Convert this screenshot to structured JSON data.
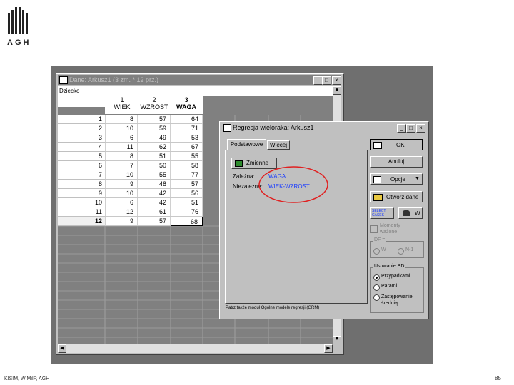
{
  "slide": {
    "logo_text": "AGH",
    "footer_left": "KISIM, WIMiIP, AGH",
    "page_number": "85"
  },
  "sheet_window": {
    "title": "Dane: Arkusz1 (3 zm. * 12 prz.)",
    "corner_label": "Dziecko",
    "columns": [
      {
        "num": "1",
        "name": "WIEK"
      },
      {
        "num": "2",
        "name": "WZROST"
      },
      {
        "num": "3",
        "name": "WAGA"
      }
    ],
    "rows": [
      {
        "n": "1",
        "values": [
          "8",
          "57",
          "64"
        ]
      },
      {
        "n": "2",
        "values": [
          "10",
          "59",
          "71"
        ]
      },
      {
        "n": "3",
        "values": [
          "6",
          "49",
          "53"
        ]
      },
      {
        "n": "4",
        "values": [
          "11",
          "62",
          "67"
        ]
      },
      {
        "n": "5",
        "values": [
          "8",
          "51",
          "55"
        ]
      },
      {
        "n": "6",
        "values": [
          "7",
          "50",
          "58"
        ]
      },
      {
        "n": "7",
        "values": [
          "10",
          "55",
          "77"
        ]
      },
      {
        "n": "8",
        "values": [
          "9",
          "48",
          "57"
        ]
      },
      {
        "n": "9",
        "values": [
          "10",
          "42",
          "56"
        ]
      },
      {
        "n": "10",
        "values": [
          "6",
          "42",
          "51"
        ]
      },
      {
        "n": "11",
        "values": [
          "12",
          "61",
          "76"
        ]
      },
      {
        "n": "12",
        "values": [
          "9",
          "57",
          "68"
        ]
      }
    ]
  },
  "dialog": {
    "title": "Regresja wieloraka: Arkusz1",
    "tabs": [
      "Podstawowe",
      "Więcej"
    ],
    "variables_button": "Zmienne",
    "dependent_label": "Zależna:",
    "dependent_value": "WAGA",
    "independent_label": "Niezależne:",
    "independent_value": "WIEK-WZROST",
    "status_text": "Patrz także moduł Ogólne modele regresji (GRM)",
    "ok_button": "OK",
    "cancel_button": "Anuluj",
    "options_button": "Opcje",
    "open_data_button": "Otwórz dane",
    "select_cases_button": "SELECT CASES",
    "weights_button": "W",
    "moments_label": "Momenty ważone",
    "df_group_label": "DF =",
    "df_options": [
      "W",
      "N-1"
    ],
    "md_group_label": "Usuwanie BD",
    "md_options": [
      "Przypadkami",
      "Parami",
      "Zastępowanie średnią"
    ],
    "md_selected": 0,
    "annotation_color": "#e02020"
  }
}
